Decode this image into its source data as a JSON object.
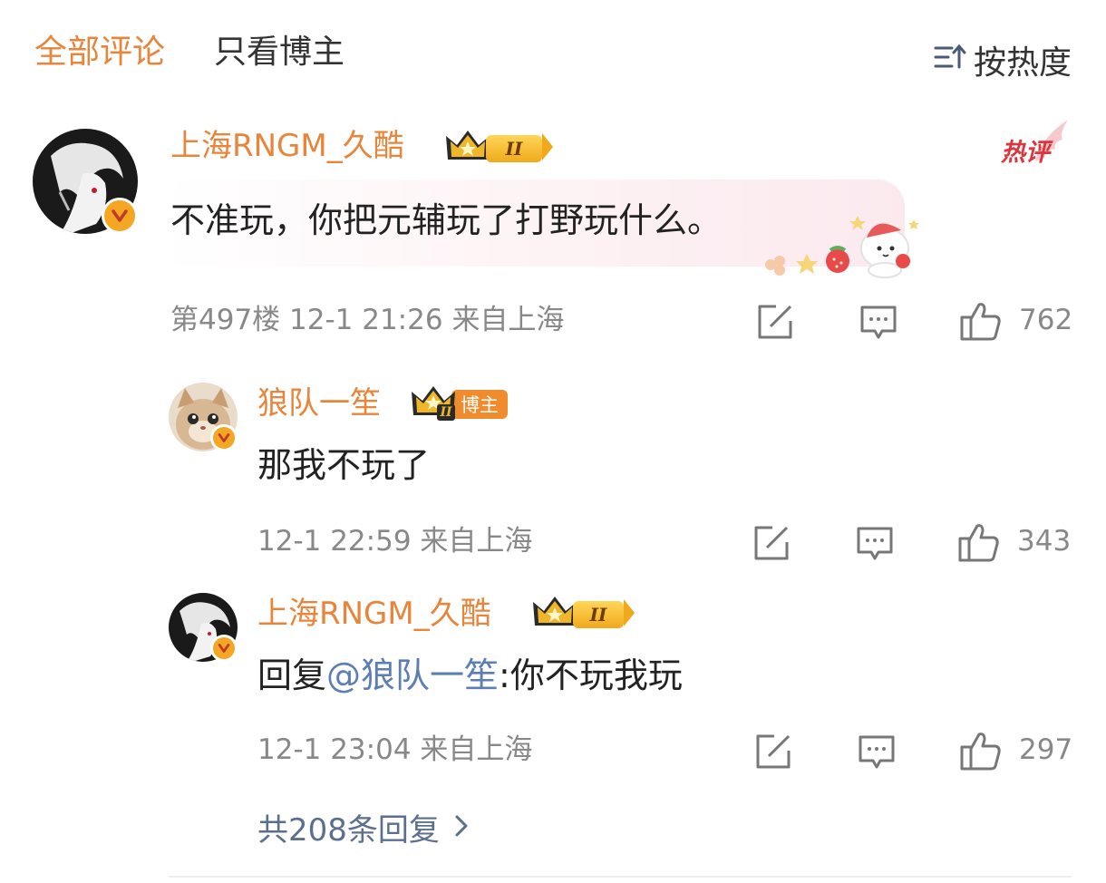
{
  "tabs": {
    "all_comments": "全部评论",
    "blogger_only": "只看博主",
    "sort_by_hot": "按热度"
  },
  "icons": {
    "sort": "sort-icon",
    "comment_action": "repost-icon",
    "reply_action": "comment-icon",
    "like_action": "thumbs-up-icon",
    "verified": "verified-v-icon",
    "crown": "crown-icon",
    "chevron": "chevron-right-icon"
  },
  "colors": {
    "accent": "#e8853a",
    "mention": "#5b7fb5",
    "hot_label": "#d9363e",
    "meta": "#888888"
  },
  "hot_label": "热评",
  "main_comment": {
    "username": "上海RNGM_久酷",
    "level": "II",
    "text": "不准玩，你把元辅玩了打野玩什么。",
    "floor": "第497楼",
    "time": "12-1 21:26",
    "location": "来自上海",
    "likes": "762"
  },
  "replies": [
    {
      "username": "狼队一笙",
      "level": "II",
      "host_tag": "博主",
      "text": "那我不玩了",
      "time": "12-1 22:59",
      "location": "来自上海",
      "likes": "343"
    },
    {
      "username": "上海RNGM_久酷",
      "level": "II",
      "prefix": "回复",
      "mention": "@狼队一笙",
      "text": ":你不玩我玩",
      "time": "12-1 23:04",
      "location": "来自上海",
      "likes": "297"
    }
  ],
  "more_replies": "共208条回复"
}
